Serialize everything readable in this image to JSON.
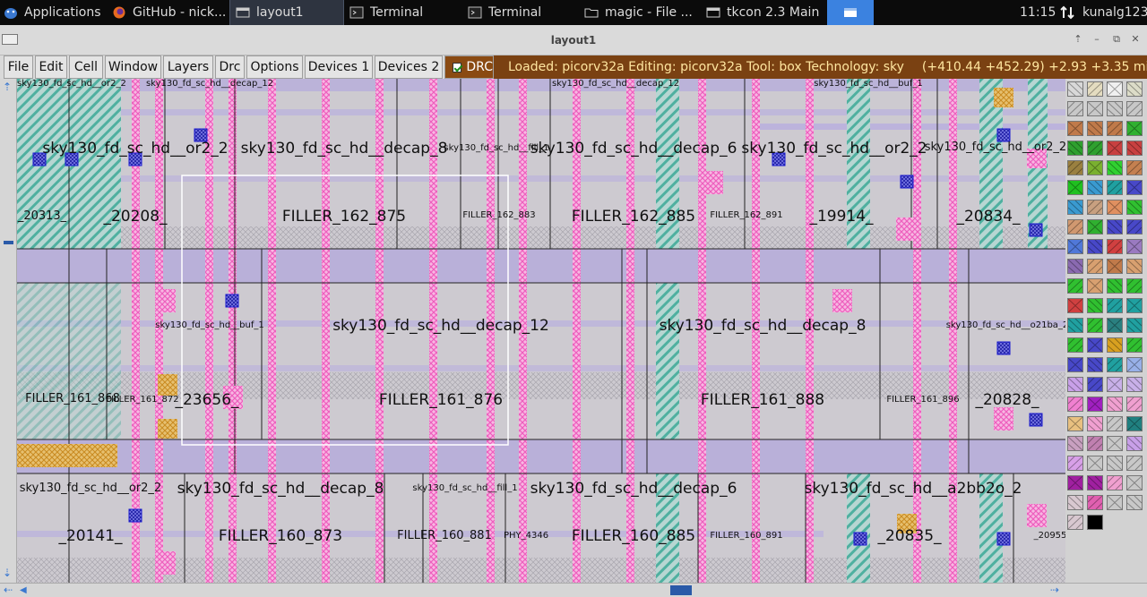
{
  "taskbar": {
    "items": [
      {
        "label": "Applications",
        "icon": "xfce-mouse-icon"
      },
      {
        "label": "GitHub - nick...",
        "icon": "firefox-icon"
      },
      {
        "label": "layout1",
        "icon": "window-icon"
      },
      {
        "label": "Terminal",
        "icon": "terminal-icon"
      },
      {
        "label": "Terminal",
        "icon": "terminal-icon"
      },
      {
        "label": "magic - File ...",
        "icon": "folder-icon"
      },
      {
        "label": "tkcon 2.3 Main",
        "icon": "window-icon"
      }
    ],
    "clock": "11:15",
    "user": "kunalg123"
  },
  "window": {
    "title": "layout1"
  },
  "menu": {
    "items": [
      "File",
      "Edit",
      "Cell",
      "Window",
      "Layers",
      "Drc",
      "Options",
      "Devices 1",
      "Devices 2"
    ],
    "drc_label": "DRC",
    "drc_checked": true
  },
  "status": {
    "text": "Loaded: picorv32a Editing: picorv32a Tool: box  Technology: sky",
    "coords": "(+410.44 +452.29) +2.93 +3.35 microns"
  },
  "colors": {
    "status_bg": "#7a4112",
    "status_text": "#ffe6a0",
    "drc_bg": "#8a4a12",
    "layout_bg": "#cdcad0",
    "metal1": "#b9b0d9",
    "poly": "#f27ac9",
    "diff": "#5fb7a9",
    "contact": "#2c2cd0"
  },
  "cells": {
    "row1_top": [
      "sky130_fd_sc_hd__or2_2",
      "sky130_fd_sc_hd__decap_8",
      "sky130_fd_sc_hd__fill_1",
      "sky130_fd_sc_hd__decap_6",
      "sky130_fd_sc_hd__or2_2",
      "sky130_fd_sc_hd__or2_2",
      "sky130_fd_sc_hd__decap_12",
      "sky130_fd_sc_hd__decap_12",
      "sky130_fd_sc_hd__buf_1"
    ],
    "row1_bottom": [
      "_20313_",
      "_20208_",
      "FILLER_162_875",
      "FILLER_162_883",
      "FILLER_162_885",
      "FILLER_162_891",
      "_19914_",
      "_20834_"
    ],
    "row2_top": [
      "sky130_fd_sc_hd__buf_1",
      "sky130_fd_sc_hd__decap_12",
      "sky130_fd_sc_hd__decap_8",
      "sky130_fd_sc_hd__o21ba_2"
    ],
    "row2_bottom": [
      "FILLER_161_868",
      "FILLER_161_872",
      "_23656_",
      "FILLER_161_876",
      "FILLER_161_888",
      "FILLER_161_896",
      "_20828_"
    ],
    "row3_top": [
      "sky130_fd_sc_hd__or2_2",
      "sky130_fd_sc_hd__decap_8",
      "sky130_fd_sc_hd__decap_6",
      "sky130_fd_sc_hd__fill_1",
      "sky130_fd_sc_hd__a2bb2o_2"
    ],
    "row3_bottom": [
      "_20141_",
      "FILLER_160_873",
      "FILLER_160_881",
      "PHY_4346",
      "FILLER_160_885",
      "FILLER_160_891",
      "_20835_",
      "_20955"
    ]
  }
}
